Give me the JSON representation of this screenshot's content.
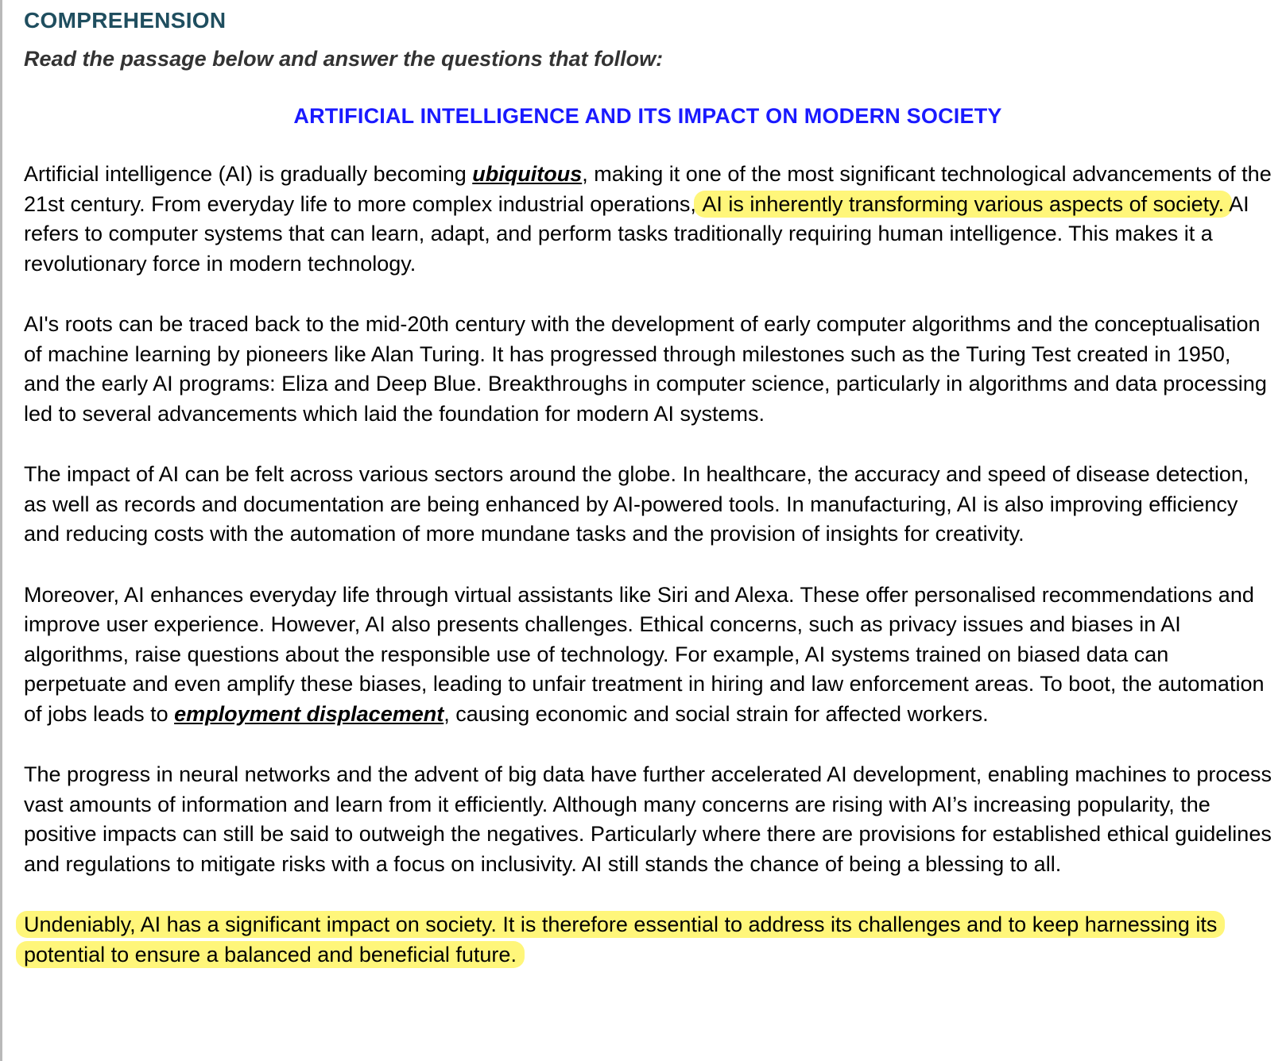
{
  "section_heading": "COMPREHENSION",
  "instruction": "Read the passage below and answer the questions that follow:",
  "passage_title": "ARTIFICIAL INTELLIGENCE AND ITS IMPACT ON MODERN SOCIETY",
  "colors": {
    "heading": "#1f4e5f",
    "title": "#1a1aff",
    "highlight": "#fff67a"
  },
  "paragraphs": {
    "p1": {
      "a": "Artificial intelligence (AI) is gradually becoming ",
      "kw": "ubiquitous",
      "b": ", making it one of the most significant technological advancements of the 21st century. From everyday life to more complex industrial operations, ",
      "hl": "AI is inherently transforming various aspects of society.",
      "c": " AI refers to computer systems that can learn, adapt, and perform tasks traditionally requiring human intelligence. This makes it a revolutionary force in modern technology."
    },
    "p2": "AI's roots can be traced back to the mid-20th century with the development of early computer algorithms and the conceptualisation of machine learning by pioneers like Alan Turing. It has progressed through milestones such as the Turing Test created in 1950, and the early AI programs: Eliza and Deep Blue. Breakthroughs in computer science, particularly in algorithms and data processing led to several advancements which laid the foundation for modern AI systems.",
    "p3": "The impact of AI can be felt across various sectors around the globe. In healthcare, the accuracy and speed of disease detection, as well as records and documentation are being enhanced by AI-powered tools. In manufacturing, AI is also improving efficiency and reducing costs with the automation of more mundane tasks and the provision of insights for creativity.",
    "p4": {
      "a": "Moreover, AI enhances everyday life through virtual assistants like Siri and Alexa. These offer personalised recommendations and improve user experience.  However, AI also presents challenges. Ethical concerns, such as privacy issues and biases in AI algorithms, raise questions about the responsible use of technology. For example, AI systems trained on biased data can perpetuate and even amplify these biases, leading to unfair treatment in hiring and law enforcement areas. To boot, the automation of jobs leads to ",
      "kw": "employment displacement",
      "b": ", causing economic and social strain for affected workers."
    },
    "p5": "The progress in neural networks and the advent of big data have further accelerated AI development, enabling machines to process vast amounts of information and learn from it efficiently.  Although many concerns are rising with AI’s increasing popularity, the positive impacts can still be said to outweigh the negatives. Particularly where there are provisions for established ethical guidelines and regulations to mitigate risks with a focus on inclusivity. AI still stands the chance of being a blessing to all.",
    "p6": "Undeniably, AI has a significant impact on society. It is therefore essential to address its challenges and to keep harnessing its potential to ensure a balanced and beneficial future."
  }
}
